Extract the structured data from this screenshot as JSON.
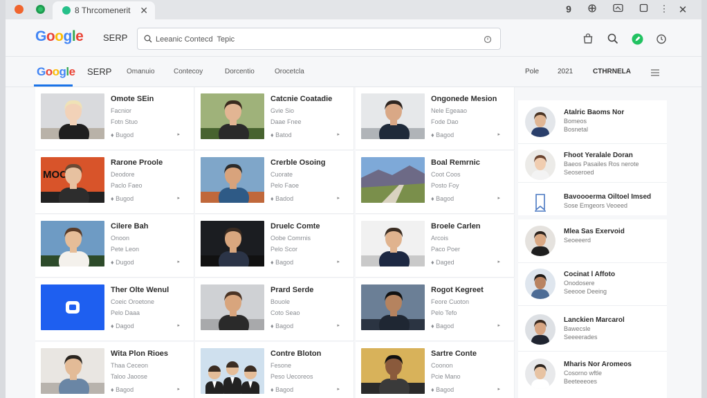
{
  "browser": {
    "tab_label": "Thrcomenerit",
    "tab_counter": "8",
    "toolbar_number": "9"
  },
  "header": {
    "logo_letters": [
      "G",
      "o",
      "o",
      "g",
      "l",
      "e"
    ],
    "logo_colors": [
      "#4285f4",
      "#ea4335",
      "#fbbc05",
      "#4285f4",
      "#34a853",
      "#ea4335"
    ],
    "serp_label": "SERP",
    "search_value": "Leeanic Contecd  Tepic"
  },
  "nav": {
    "serp_label": "SERP",
    "links": [
      "Omanuio",
      "Contecoy",
      "Dorcentio",
      "Orocetcla"
    ],
    "right_items": [
      "Pole",
      "2021",
      "CTHRNELA"
    ]
  },
  "results": [
    {
      "title": "Omote SEin",
      "line1": "Facnior",
      "line2": "Fotn Stuo",
      "meta": "♦ Bugod",
      "arrow": "▸"
    },
    {
      "title": "Catcnie Coatadie",
      "line1": "Gvie Sio",
      "line2": "Daae Fnee",
      "meta": "♦ Batod",
      "arrow": "▸"
    },
    {
      "title": "Ongonede Mesion",
      "line1": "Nele Egeaao",
      "line2": "Fode Dao",
      "meta": "♦ Bagod",
      "arrow": "▸"
    },
    {
      "title": "Rarone Proole",
      "line1": "Deodore",
      "line2": "Paclo Faeo",
      "meta": "♦ Bugod",
      "arrow": "▸"
    },
    {
      "title": "Crerble Osoing",
      "line1": "Cuorate",
      "line2": "Pelo Faoe",
      "meta": "♦ Badod",
      "arrow": "▸"
    },
    {
      "title": "Boal Remrnic",
      "line1": "Coot Coos",
      "line2": "Posto Foy",
      "meta": "♦ Bagod",
      "arrow": "▸"
    },
    {
      "title": "Cilere Bah",
      "line1": "Onoon",
      "line2": "Pete Leon",
      "meta": "♦ Dugod",
      "arrow": "▸"
    },
    {
      "title": "Druelc Comte",
      "line1": "Oobe Comrnis",
      "line2": "Pelo Scor",
      "meta": "♦ Bagod",
      "arrow": "▸"
    },
    {
      "title": "Broele Carlen",
      "line1": "Arcois",
      "line2": "Paco Poer",
      "meta": "♦ Daged",
      "arrow": "▸"
    },
    {
      "title": "Ther Olte Wenul",
      "line1": "Coeic Oroetone",
      "line2": "Pelo Daaa",
      "meta": "♦ Dagod",
      "arrow": "▸"
    },
    {
      "title": "Prard Serde",
      "line1": "Bouole",
      "line2": "Coto Seao",
      "meta": "♦ Bagod",
      "arrow": "▸"
    },
    {
      "title": "Rogot Kegreet",
      "line1": "Feore Cuoton",
      "line2": "Pelo Tefo",
      "meta": "♦ Bagod",
      "arrow": "▸"
    },
    {
      "title": "Wita Plon Rioes",
      "line1": "Thaa Ceceon",
      "line2": "Taloo Jaoose",
      "meta": "♦ Bagod",
      "arrow": "▸"
    },
    {
      "title": "Contre Bloton",
      "line1": "Fesone",
      "line2": "Peso Uecoreos",
      "meta": "♦ Bagod",
      "arrow": "▸"
    },
    {
      "title": "Sartre Conte",
      "line1": "Coonon",
      "line2": "Pcie Mano",
      "meta": "♦ Bagod",
      "arrow": "▸"
    }
  ],
  "sidebar": {
    "items": [
      {
        "name": "Atalric Baoms Nor",
        "sub1": "Bomeos",
        "sub2": "Bosnetal"
      },
      {
        "name": "Fhoot Yeralale Doran",
        "sub1": "Baeos Pasailes Ros nerote",
        "sub2": "Seoseroed"
      },
      {
        "name": "Bavoooerma Oiltoel Imsed",
        "sub1": "Sose Emgeors Veoeed",
        "sub2": ""
      },
      {
        "name": "Mlea Sas Exervoid",
        "sub1": "Seoeeerd",
        "sub2": ""
      },
      {
        "name": "Cocinat l Affoto",
        "sub1": "Onodosere",
        "sub2": "Seeooe Deeing"
      },
      {
        "name": "Lanckien Marcarol",
        "sub1": "Bawecsle",
        "sub2": "Seeeerades"
      },
      {
        "name": "Mharis Nor Aromeos",
        "sub1": "Cosorno wftle",
        "sub2": "Beeteeeoes"
      }
    ]
  }
}
